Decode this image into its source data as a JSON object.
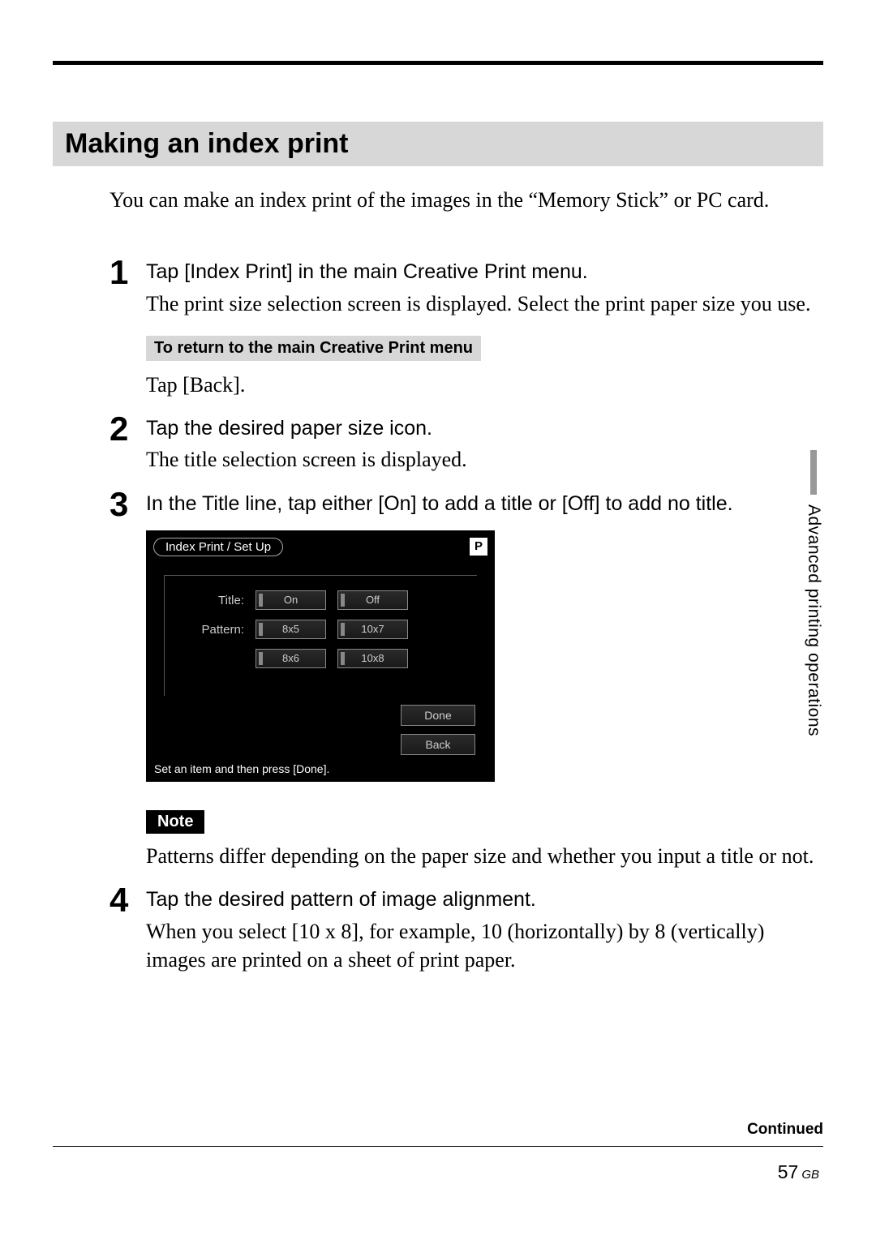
{
  "section_title": "Making an index print",
  "intro": "You can make an index print of the images in the “Memory Stick” or PC card.",
  "steps": [
    {
      "num": "1",
      "head": "Tap [Index Print] in the main Creative Print menu.",
      "text": "The print size selection screen is displayed. Select the print paper size you use.",
      "subhead": "To return to the main Creative Print menu",
      "subtext": "Tap [Back]."
    },
    {
      "num": "2",
      "head": "Tap the desired paper size icon.",
      "text": "The title selection screen is displayed."
    },
    {
      "num": "3",
      "head": "In the Title line, tap either [On] to add a title or [Off] to add no title."
    },
    {
      "num": "4",
      "head": "Tap the desired pattern of image alignment.",
      "text": "When you select [10 x 8], for example, 10 (horizontally) by 8 (vertically) images are printed on a sheet of print paper."
    }
  ],
  "screen": {
    "tab": "Index Print / Set Up",
    "p_icon": "P",
    "rows": [
      {
        "label": "Title:",
        "buttons": [
          "On",
          "Off"
        ]
      },
      {
        "label": "Pattern:",
        "buttons": [
          "8x5",
          "10x7"
        ]
      },
      {
        "label": "",
        "buttons": [
          "8x6",
          "10x8"
        ]
      }
    ],
    "actions": [
      "Done",
      "Back"
    ],
    "status": "Set an item and then press [Done]."
  },
  "note_label": "Note",
  "note_text": "Patterns differ depending on the paper size and whether you input a title or not.",
  "side_tab": "Advanced printing operations",
  "continued": "Continued",
  "page_number": "57",
  "page_region": "GB"
}
